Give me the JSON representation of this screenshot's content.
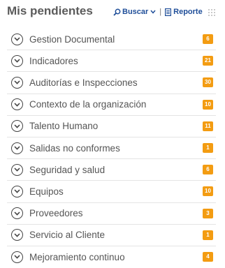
{
  "header": {
    "title": "Mis pendientes",
    "buscar_label": "Buscar",
    "separator": "|",
    "reporte_label": "Reporte"
  },
  "colors": {
    "badge": "#f39c12",
    "link": "#1f4e99"
  },
  "items": [
    {
      "label": "Gestion Documental",
      "count": "6"
    },
    {
      "label": "Indicadores",
      "count": "21"
    },
    {
      "label": "Auditorías e Inspecciones",
      "count": "30"
    },
    {
      "label": "Contexto de la organización",
      "count": "10"
    },
    {
      "label": "Talento Humano",
      "count": "11"
    },
    {
      "label": "Salidas no conformes",
      "count": "1"
    },
    {
      "label": "Seguridad y salud",
      "count": "6"
    },
    {
      "label": "Equipos",
      "count": "10"
    },
    {
      "label": "Proveedores",
      "count": "3"
    },
    {
      "label": "Servicio al Cliente",
      "count": "1"
    },
    {
      "label": "Mejoramiento continuo",
      "count": "4"
    }
  ]
}
